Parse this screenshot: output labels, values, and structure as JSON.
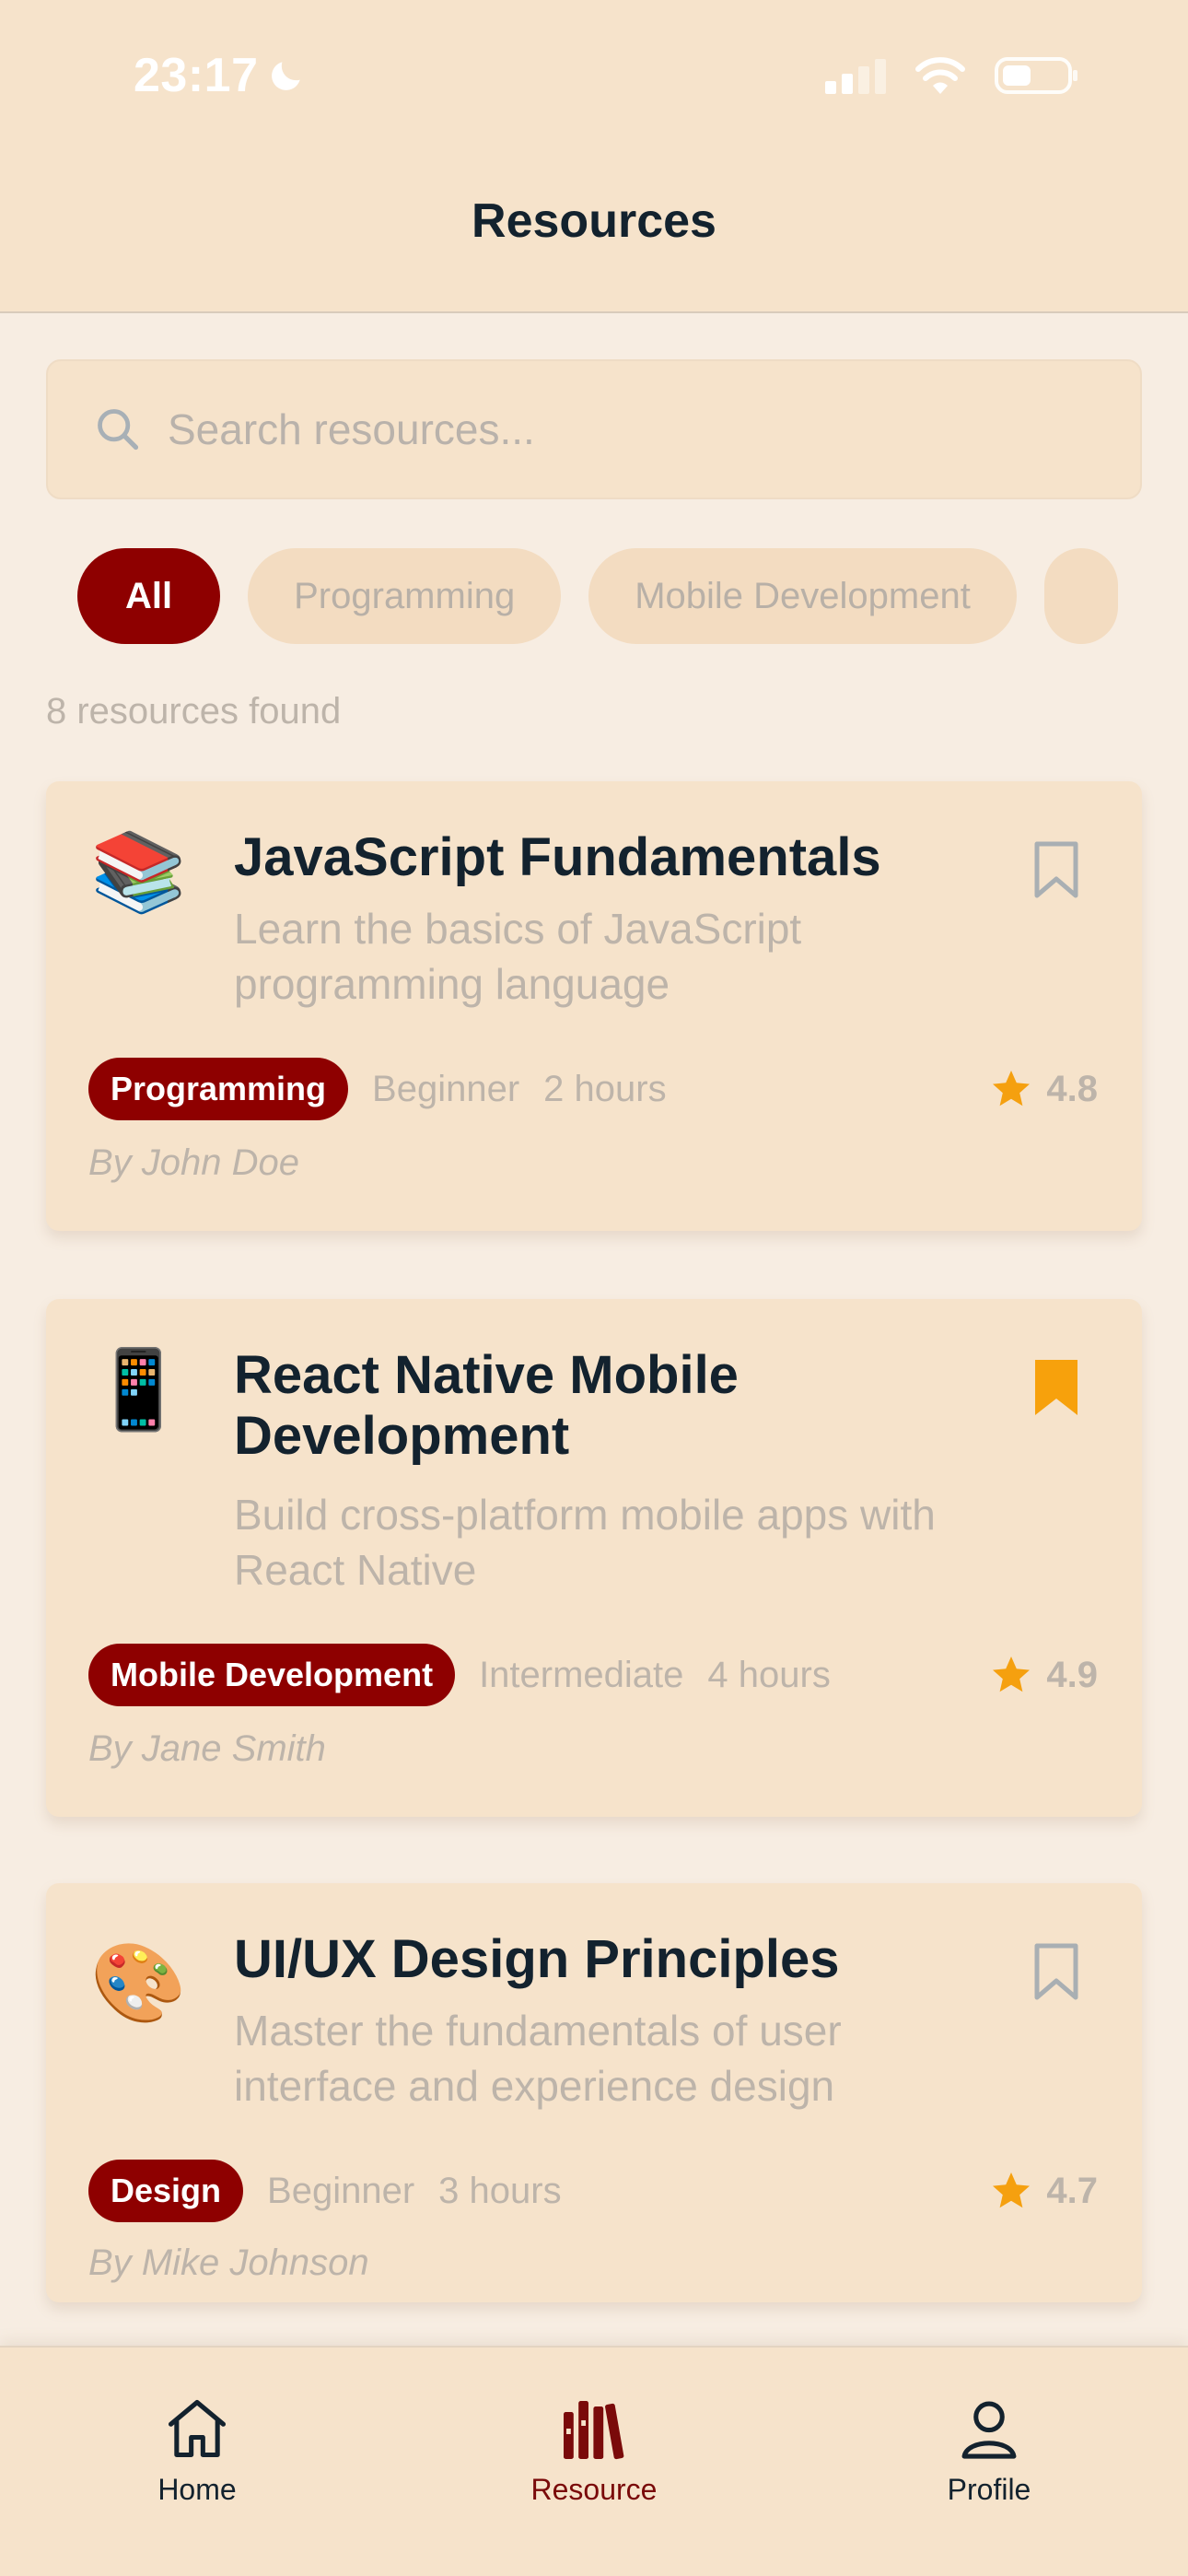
{
  "status_bar": {
    "time": "23:17"
  },
  "header": {
    "title": "Resources"
  },
  "search": {
    "placeholder": "Search resources..."
  },
  "filters": [
    {
      "label": "All",
      "active": true
    },
    {
      "label": "Programming",
      "active": false
    },
    {
      "label": "Mobile Development",
      "active": false
    }
  ],
  "results": {
    "count_text": "8 resources found"
  },
  "resources": [
    {
      "emoji": "📚",
      "title": "JavaScript Fundamentals",
      "description": "Learn the basics of JavaScript programming language",
      "category": "Programming",
      "level": "Beginner",
      "duration": "2 hours",
      "rating": "4.8",
      "author": "By John Doe",
      "bookmarked": false
    },
    {
      "emoji": "📱",
      "title": "React Native Mobile Development",
      "description": "Build cross-platform mobile apps with React Native",
      "category": "Mobile Development",
      "level": "Intermediate",
      "duration": "4 hours",
      "rating": "4.9",
      "author": "By Jane Smith",
      "bookmarked": true
    },
    {
      "emoji": "🎨",
      "title": "UI/UX Design Principles",
      "description": "Master the fundamentals of user interface and experience design",
      "category": "Design",
      "level": "Beginner",
      "duration": "3 hours",
      "rating": "4.7",
      "author": "By Mike Johnson",
      "bookmarked": false
    }
  ],
  "nav": {
    "home": "Home",
    "resource": "Resource",
    "profile": "Profile",
    "active": "resource"
  },
  "colors": {
    "accent": "#8e0000",
    "star": "#f5a00f",
    "bookmark_active": "#f7a10c",
    "background": "#f7ede2",
    "card": "#f6e3cb"
  }
}
